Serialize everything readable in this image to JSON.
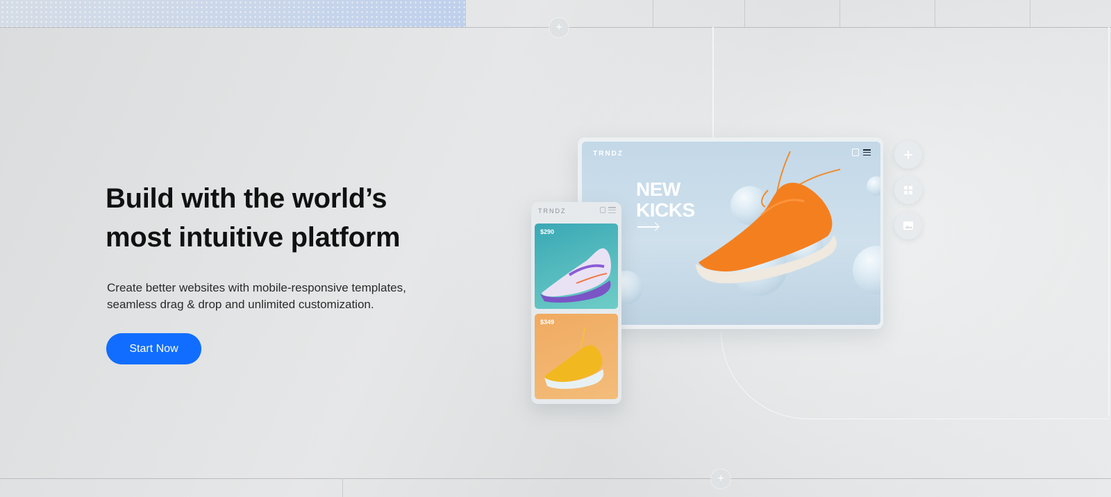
{
  "hero": {
    "title_line1": "Build with the world’s",
    "title_line2": "most intuitive platform",
    "subtitle_line1": "Create better websites with mobile-responsive templates,",
    "subtitle_line2": "seamless drag & drop and unlimited customization.",
    "cta_label": "Start Now"
  },
  "desktop_mockup": {
    "logo": "TRNDZ",
    "headline_line1": "NEW",
    "headline_line2": "KICKS",
    "icons": [
      "shopping-bag-icon",
      "menu-icon"
    ]
  },
  "mobile_mockup": {
    "logo": "TRNDZ",
    "products": [
      {
        "price": "$290"
      },
      {
        "price": "$349"
      }
    ]
  },
  "tools": [
    "plus-icon",
    "grid-icon",
    "image-icon"
  ],
  "colors": {
    "accent": "#116dff",
    "background": "#e3e5e6",
    "title_text": "#111111"
  }
}
